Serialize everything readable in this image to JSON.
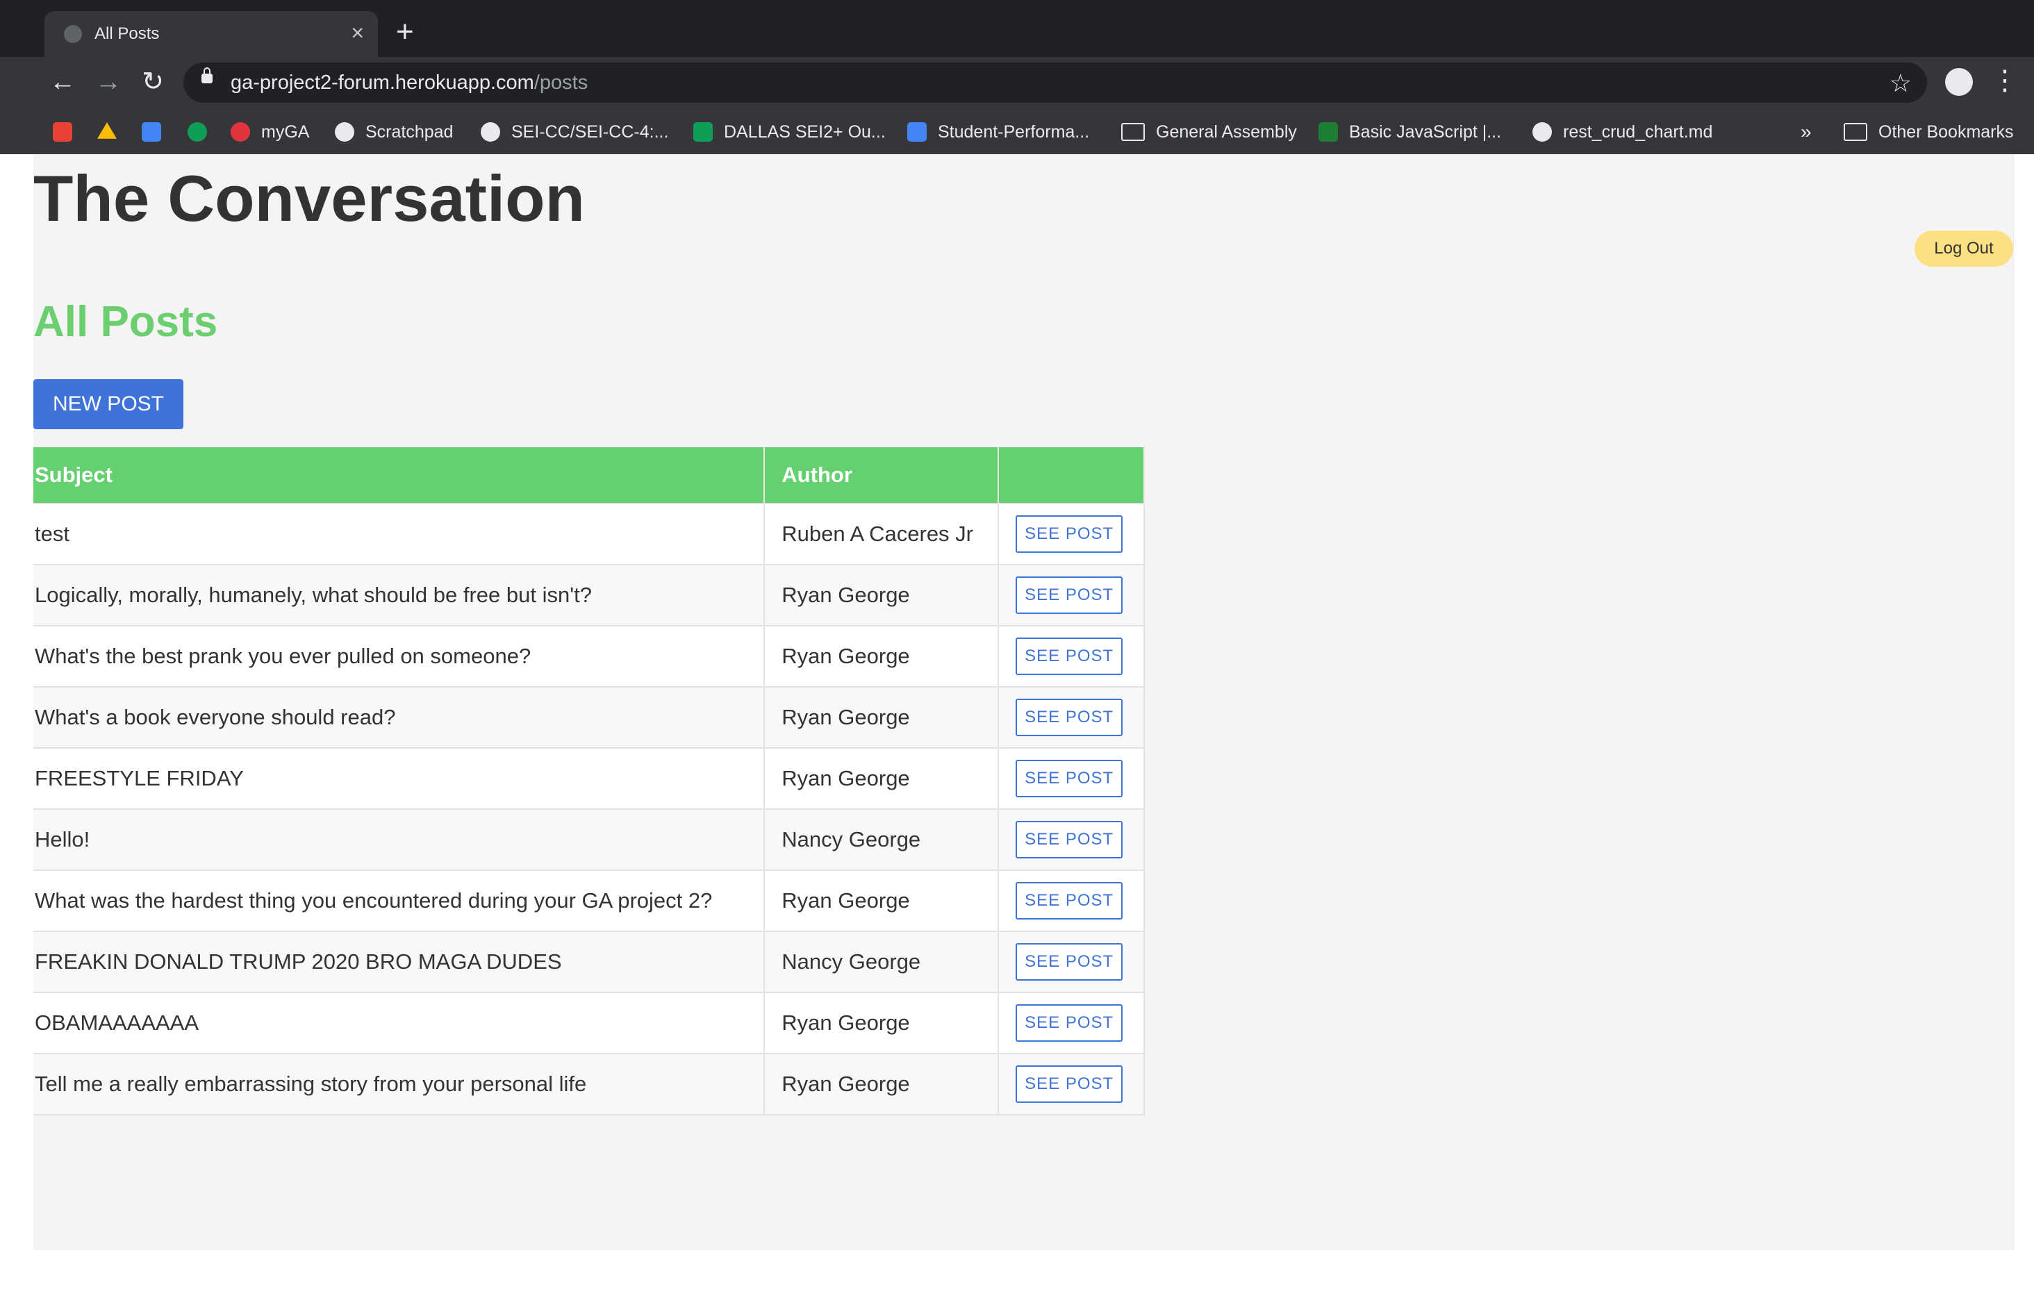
{
  "browser": {
    "tab_title": "All Posts",
    "url_host": "ga-project2-forum.herokuapp.com",
    "url_path": "/posts",
    "bookmarks": [
      {
        "label": "",
        "icon": "gmail-icon"
      },
      {
        "label": "",
        "icon": "google-drive-icon"
      },
      {
        "label": "",
        "icon": "calendar-icon"
      },
      {
        "label": "",
        "icon": "hangouts-icon"
      },
      {
        "label": "myGA",
        "icon": "ga-icon"
      },
      {
        "label": "Scratchpad",
        "icon": "globe-icon"
      },
      {
        "label": "SEI-CC/SEI-CC-4:...",
        "icon": "github-icon"
      },
      {
        "label": "DALLAS SEI2+ Ou...",
        "icon": "sheets-icon"
      },
      {
        "label": "Student-Performa...",
        "icon": "docs-icon"
      },
      {
        "label": "General Assembly",
        "icon": "folder-icon"
      },
      {
        "label": "Basic JavaScript |...",
        "icon": "code-icon"
      },
      {
        "label": "rest_crud_chart.md",
        "icon": "github-icon"
      }
    ],
    "overflow_label": "»",
    "other_bookmarks": "Other Bookmarks"
  },
  "page": {
    "site_title": "The Conversation",
    "logout_label": "Log Out",
    "section_title": "All Posts",
    "new_post_label": "NEW POST",
    "table": {
      "headers": [
        "Subject",
        "Author",
        ""
      ],
      "action_label": "SEE POST",
      "rows": [
        {
          "subject": "test",
          "author": "Ruben A Caceres Jr"
        },
        {
          "subject": "Logically, morally, humanely, what should be free but isn't?",
          "author": "Ryan George"
        },
        {
          "subject": "What's the best prank you ever pulled on someone?",
          "author": "Ryan George"
        },
        {
          "subject": "What's a book everyone should read?",
          "author": "Ryan George"
        },
        {
          "subject": "FREESTYLE FRIDAY",
          "author": "Ryan George"
        },
        {
          "subject": "Hello!",
          "author": "Nancy George"
        },
        {
          "subject": "What was the hardest thing you encountered during your GA project 2?",
          "author": "Ryan George"
        },
        {
          "subject": "FREAKIN DONALD TRUMP 2020 BRO MAGA DUDES",
          "author": "Nancy George"
        },
        {
          "subject": "OBAMAAAAAAA",
          "author": "Ryan George"
        },
        {
          "subject": "Tell me a really embarrassing story from your personal life",
          "author": "Ryan George"
        }
      ]
    }
  },
  "colors": {
    "title_text": "#333333",
    "section_title": "#6ccf6f",
    "table_header": "#65d06f",
    "primary_button": "#3f73d8",
    "logout_button": "#fce083",
    "page_background": "#f4f4f4"
  }
}
